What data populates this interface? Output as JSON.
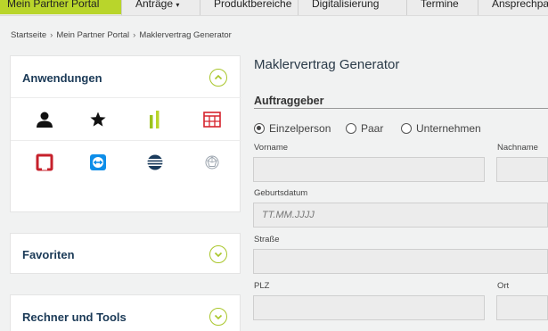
{
  "topnav": {
    "tabs": [
      {
        "label": "Mein Partner Portal",
        "active": true
      },
      {
        "label": "Anträge",
        "chevron": "chevron-down-icon"
      },
      {
        "label": "Produktbereiche"
      },
      {
        "label": "Digitalisierung"
      },
      {
        "label": "Termine"
      },
      {
        "label": "Ansprechpartner"
      }
    ],
    "accent_color": "#b9d52b"
  },
  "breadcrumb": [
    "Startseite",
    "Mein Partner Portal",
    "Maklervertrag Generator"
  ],
  "sidebar": {
    "anwendungen": {
      "title": "Anwendungen",
      "apps": [
        {
          "icon": "person-icon"
        },
        {
          "icon": "star-icon"
        },
        {
          "icon": "green-bars-icon"
        },
        {
          "icon": "red-building-icon"
        },
        {
          "icon": "red-square-icon"
        },
        {
          "icon": "teamviewer-icon"
        },
        {
          "icon": "globe-stripes-icon"
        },
        {
          "icon": "network-icon"
        }
      ]
    },
    "favoriten": {
      "title": "Favoriten"
    },
    "rechner": {
      "title": "Rechner und Tools"
    }
  },
  "main": {
    "title": "Maklervertrag Generator",
    "section": "Auftraggeber",
    "radio_options": [
      {
        "label": "Einzelperson",
        "selected": true
      },
      {
        "label": "Paar",
        "selected": false
      },
      {
        "label": "Unternehmen",
        "selected": false
      }
    ],
    "fields": {
      "vorname": {
        "label": "Vorname",
        "value": ""
      },
      "nachname": {
        "label": "Nachname",
        "value": ""
      },
      "geburtsdatum": {
        "label": "Geburtsdatum",
        "placeholder": "TT.MM.JJJJ"
      },
      "strasse": {
        "label": "Straße",
        "value": ""
      },
      "plz": {
        "label": "PLZ",
        "value": ""
      },
      "ort": {
        "label": "Ort",
        "value": ""
      }
    }
  }
}
